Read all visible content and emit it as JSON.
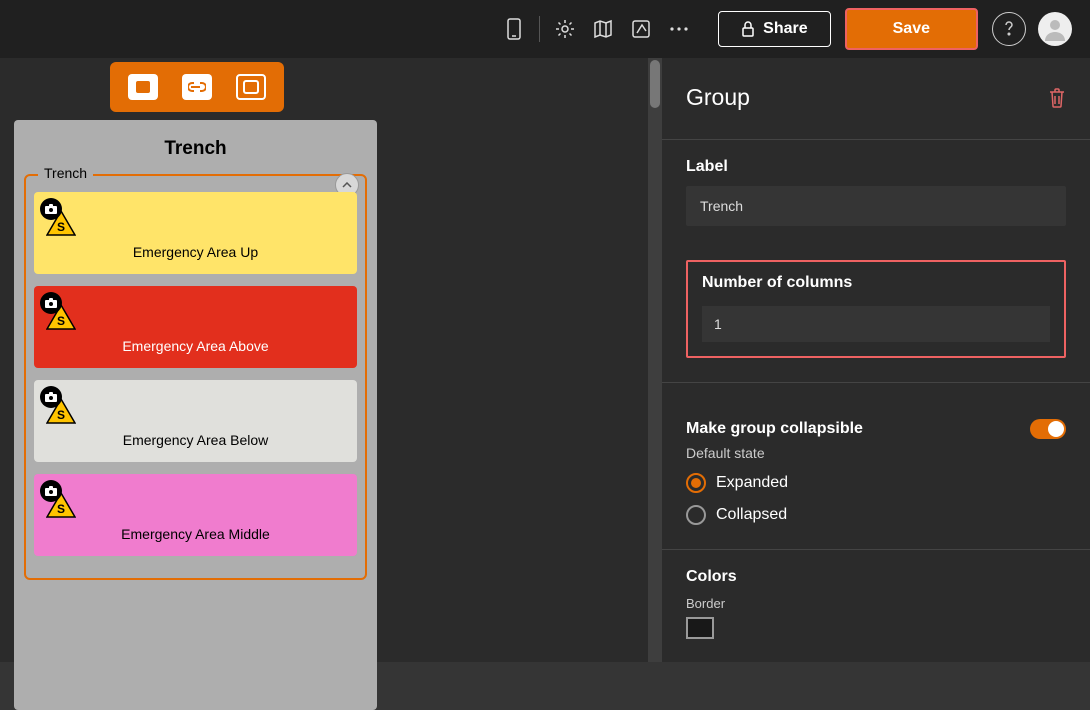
{
  "topbar": {
    "share_label": "Share",
    "save_label": "Save"
  },
  "canvas": {
    "title": "Trench",
    "group_label": "Trench",
    "cards": [
      {
        "label": "Emergency Area Up"
      },
      {
        "label": "Emergency Area Above"
      },
      {
        "label": "Emergency Area Below"
      },
      {
        "label": "Emergency Area Middle"
      }
    ]
  },
  "panel": {
    "heading": "Group",
    "label_title": "Label",
    "label_value": "Trench",
    "columns_title": "Number of columns",
    "columns_value": "1",
    "collapsible_title": "Make group collapsible",
    "default_state_label": "Default state",
    "expanded_label": "Expanded",
    "collapsed_label": "Collapsed",
    "colors_title": "Colors",
    "border_label": "Border"
  }
}
